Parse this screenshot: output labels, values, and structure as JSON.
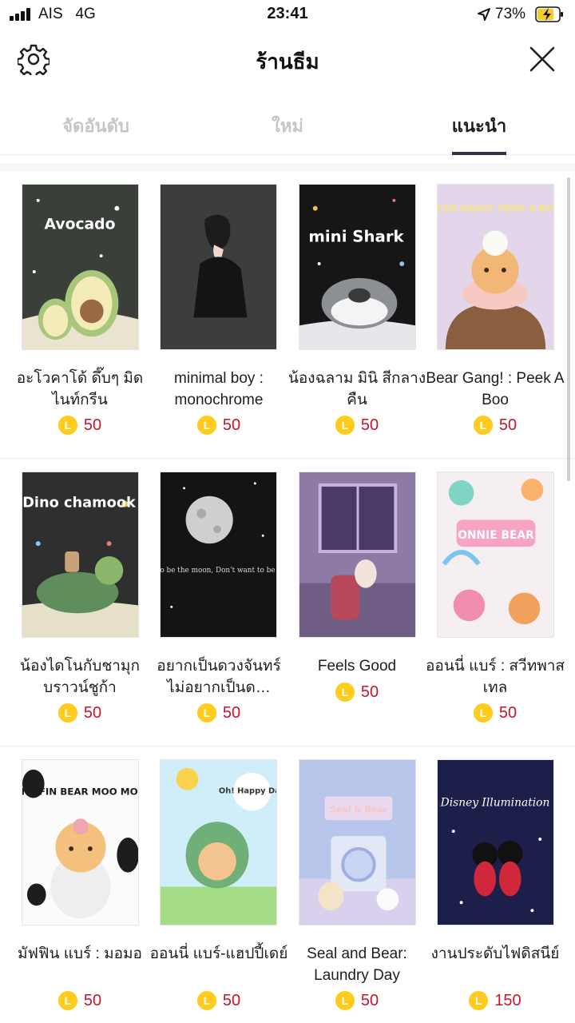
{
  "status": {
    "carrier": "AIS",
    "network": "4G",
    "time": "23:41",
    "battery": "73%"
  },
  "header": {
    "title": "ร้านธีม"
  },
  "tabs": [
    {
      "label": "จัดอันดับ"
    },
    {
      "label": "ใหม่"
    },
    {
      "label": "แนะนำ"
    }
  ],
  "coin_symbol": "L",
  "rows": [
    [
      {
        "name": "อะโวคาโด้ ดึ๊บๆ มิดไนท์กรีน",
        "price": "50",
        "art": "Avocado"
      },
      {
        "name": "minimal boy : monochrome",
        "price": "50",
        "art": ""
      },
      {
        "name": "น้องฉลาม มินิ สีกลางคืน",
        "price": "50",
        "art": "mini Shark"
      },
      {
        "name": "Bear Gang! : Peek A Boo",
        "price": "50",
        "art": "BEAR GANG! PEEK A BOO"
      }
    ],
    [
      {
        "name": "น้องไดโนกับชามุกบราวน์ชูก้า",
        "price": "50",
        "art": "Dino chamook"
      },
      {
        "name": "อยากเป็นดวงจันทร์ไม่อยากเป็นด…",
        "price": "50",
        "art": "Want to be the moon, Don't want to be a star."
      },
      {
        "name": "Feels Good",
        "price": "50",
        "art": ""
      },
      {
        "name": "ออนนี่ แบร์ : สวีทพาสเทล",
        "price": "50",
        "art": "ONNIE BEAR"
      }
    ],
    [
      {
        "name": "มัฟฟิน แบร์ : มอมอ",
        "price": "50",
        "art": "MUFFIN BEAR MOO MOO"
      },
      {
        "name": "ออนนี่ แบร์-แฮปปี้เดย์",
        "price": "50",
        "art": "Oh! Happy Day"
      },
      {
        "name": "Seal and Bear: Laundry Day",
        "price": "50",
        "art": "Seal & Bear"
      },
      {
        "name": "งานประดับไฟดิสนีย์",
        "price": "150",
        "art": "Disney Illumination"
      }
    ]
  ],
  "colors": {
    "price": "#c8152a",
    "coin": "#ffcc1d",
    "active_tab": "#2b3448"
  }
}
